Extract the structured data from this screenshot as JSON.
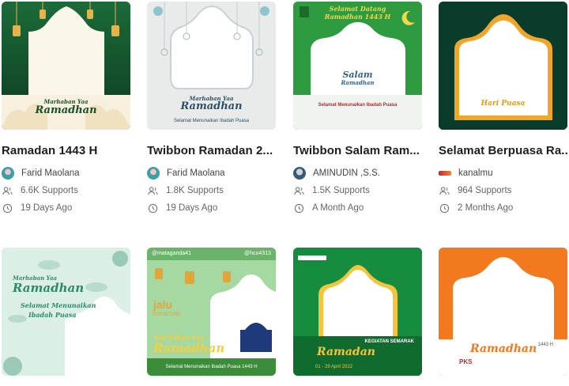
{
  "cards": [
    {
      "title": "Ramadan 1443 H",
      "author": "Farid Maolana",
      "supports": "6.6K Supports",
      "time": "19 Days Ago",
      "overlay": [
        "Marhaban Yaa",
        "Ramadhan"
      ]
    },
    {
      "title": "Twibbon Ramadan 2...",
      "author": "Farid Maolana",
      "supports": "1.8K Supports",
      "time": "19 Days Ago",
      "overlay": [
        "Marhaban Yaa",
        "Ramadhan",
        "Selamat Menunaikan Ibadah Puasa"
      ]
    },
    {
      "title": "Twibbon Salam Ram...",
      "author": "AMINUDIN ,S.S.",
      "supports": "1.5K Supports",
      "time": "A Month Ago",
      "overlay": [
        "Selamat Datang",
        "Ramadhan 1443 H",
        "Salam",
        "Ramadhan",
        "Selamat Menunaikan Ibadah Puasa"
      ]
    },
    {
      "title": "Selamat Berpuasa Ra...",
      "author": "kanalmu",
      "supports": "964 Supports",
      "time": "2 Months Ago",
      "overlay": [
        "Hari Puasa"
      ]
    },
    {
      "overlay": [
        "Marhaban Yaa",
        "Ramadhan",
        "Selamat Menunaikan",
        "Ibadah Puasa"
      ]
    },
    {
      "overlay": [
        "@mataganda41",
        "@hco4313",
        "jalu",
        "FURNITURE",
        "Marhaban Yaa",
        "Ramadhan",
        "Selamat Menunaikan Ibadah Puasa 1443 H"
      ]
    },
    {
      "overlay": [
        "KEGIATAN SEMARAK",
        "Ramadan",
        "01 - 29 April 2022"
      ]
    },
    {
      "overlay": [
        "Ramadhan",
        "1443 H",
        "PKS"
      ]
    }
  ]
}
